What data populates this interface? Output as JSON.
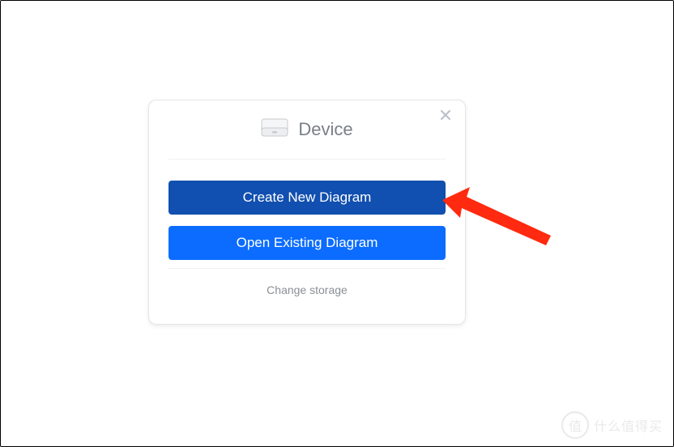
{
  "dialog": {
    "title": "Device",
    "buttons": {
      "create": "Create New Diagram",
      "open": "Open Existing Diagram"
    },
    "footer": {
      "change_storage": "Change storage"
    }
  },
  "watermark": {
    "badge": "值",
    "text": "什么值得买"
  }
}
